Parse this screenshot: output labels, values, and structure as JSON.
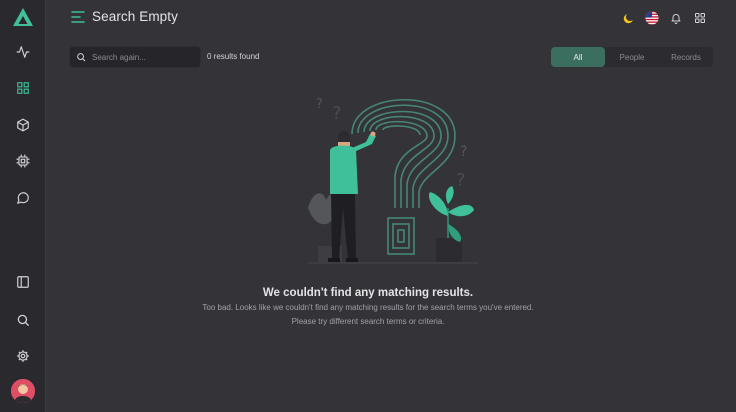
{
  "app": {
    "logo": "triangle-logo"
  },
  "header": {
    "title": "Search Empty"
  },
  "sidebar": {
    "top_items": [
      "activity-icon",
      "grid-icon",
      "cube-icon",
      "cpu-icon",
      "chat-icon"
    ],
    "bottom_items": [
      "panel-icon",
      "search-icon",
      "gear-icon"
    ],
    "active_item": "grid-icon"
  },
  "toolbar": {
    "icons": [
      "moon-icon",
      "us-flag-icon",
      "bell-icon",
      "apps-grid-icon"
    ]
  },
  "search": {
    "placeholder": "Search again...",
    "value": "",
    "results_label": "0 results found"
  },
  "filters": {
    "tabs": [
      "All",
      "People",
      "Records"
    ],
    "active": "All"
  },
  "empty_state": {
    "title": "We couldn't find any matching results.",
    "line1": "Too bad. Looks like we couldn't find any matching results for the search terms you've entered.",
    "line2": "Please try different search terms or criteria."
  },
  "colors": {
    "accent": "#3c6e5f",
    "brand": "#3fbf9a",
    "background": "#333338",
    "sidebar": "#2a2a2e"
  }
}
